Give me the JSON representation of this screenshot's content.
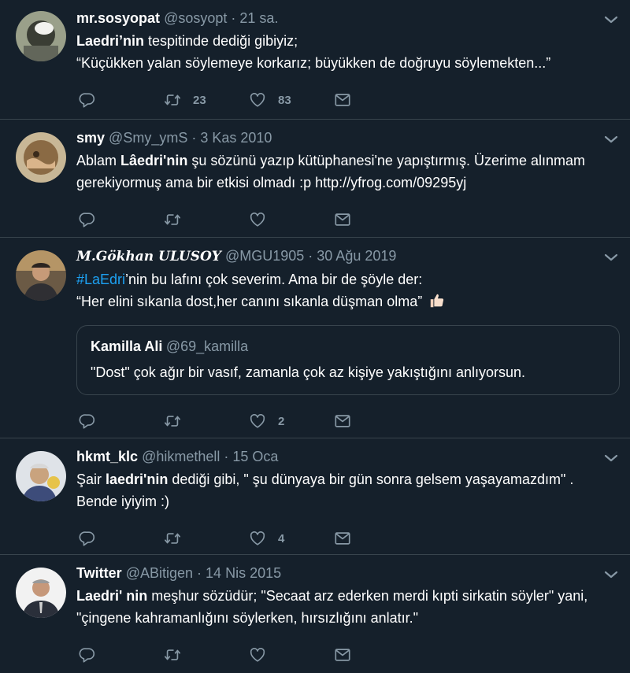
{
  "tweets": [
    {
      "name": "mr.sosyopat",
      "handle": "@sosyopt",
      "time": "21 sa.",
      "lines": [
        {
          "bold": "Laedri’nin",
          "rest": " tespitinde dediği gibiyiz;"
        },
        {
          "bold": "",
          "rest": "“Küçükken yalan söylemeye korkarız; büyükken de doğruyu söylemekten...”"
        }
      ],
      "retweets": "23",
      "likes": "83",
      "replies": ""
    },
    {
      "name": "smy",
      "handle": "@Smy_ymS",
      "time": "3 Kas 2010",
      "line1_pre": "Ablam ",
      "line1_bold": "Lâedri'nin",
      "line1_post": " şu sözünü yazıp kütüphanesi'ne yapıştırmış. Üzerime alınmam",
      "line2": "gerekiyormuş ama bir etkisi olmadı :p  http://yfrog.com/09295yj",
      "retweets": "",
      "likes": ""
    },
    {
      "name": "M.Gökhan ULUSOY",
      "handle": "@MGU1905",
      "time": "30 Ağu 2019",
      "hashtag": "#LaEdri",
      "line1_post": "’nin bu lafını çok severim. Ama bir de şöyle der:",
      "line2": "“Her elini sıkanla dost,her canını sıkanla düşman olma”",
      "quote": {
        "name": "Kamilla Ali",
        "handle": "@69_kamilla",
        "text": "\"Dost\" çok ağır bir vasıf, zamanla çok az kişiye yakıştığını anlıyorsun."
      },
      "retweets": "",
      "likes": "2"
    },
    {
      "name": "hkmt_klc",
      "handle": "@hikmethell",
      "time": "15 Oca",
      "line1_pre": "Şair ",
      "line1_bold": "laedri'nin",
      "line1_post": " dediği gibi, \" şu dünyaya bir gün sonra gelsem yaşayamazdım\" .",
      "line2": "Bende iyiyim :)",
      "retweets": "",
      "likes": "4"
    },
    {
      "name": "Twitter",
      "handle": "@ABitigen",
      "time": "14 Nis 2015",
      "line1_bold": "Laedri' nin",
      "line1_post": " meşhur sözüdür; \"Secaat arz ederken merdi kıpti sirkatin söyler\" yani,",
      "line2": "\"çingene kahramanlığını söylerken, hırsızlığını anlatır.\"",
      "retweets": "",
      "likes": ""
    }
  ],
  "separator": "·",
  "colors": {
    "background": "#15202b",
    "muted": "#8899a6",
    "accent": "#1da1f2",
    "border": "#38444d"
  },
  "icons": [
    "reply-icon",
    "retweet-icon",
    "like-icon",
    "message-icon",
    "chevron-down-icon",
    "thumbs-up-icon"
  ]
}
